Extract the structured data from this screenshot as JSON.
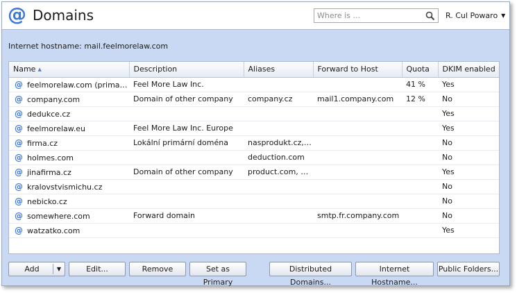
{
  "header": {
    "title": "Domains",
    "search_placeholder": "Where is ...",
    "user_name": "R. Cul Powaro"
  },
  "hostname_label": "Internet hostname: mail.feelmorelaw.com",
  "table": {
    "columns": [
      "Name",
      "Description",
      "Aliases",
      "Forward to Host",
      "Quota",
      "DKIM enabled"
    ],
    "sorted_column": "Name",
    "rows": [
      {
        "name": "feelmorelaw.com (primary)",
        "description": "Feel More Law Inc.",
        "aliases": "",
        "forward": "",
        "quota": "41 %",
        "dkim": "Yes"
      },
      {
        "name": "company.com",
        "description": "Domain of other company",
        "aliases": "company.cz",
        "forward": "mail1.company.com",
        "quota": "12 %",
        "dkim": "No"
      },
      {
        "name": "dedukce.cz",
        "description": "",
        "aliases": "",
        "forward": "",
        "quota": "",
        "dkim": "Yes"
      },
      {
        "name": "feelmorelaw.eu",
        "description": "Feel More Law Inc. Europe",
        "aliases": "",
        "forward": "",
        "quota": "",
        "dkim": "Yes"
      },
      {
        "name": "firma.cz",
        "description": "Lokální primární doména",
        "aliases": "nasprodukt.cz, fi...",
        "forward": "",
        "quota": "",
        "dkim": "No"
      },
      {
        "name": "holmes.com",
        "description": "",
        "aliases": "deduction.com",
        "forward": "",
        "quota": "",
        "dkim": "No"
      },
      {
        "name": "jinafirma.cz",
        "description": "Domain of other company",
        "aliases": "product.com, oth...",
        "forward": "",
        "quota": "",
        "dkim": "Yes"
      },
      {
        "name": "kralovstvismichu.cz",
        "description": "",
        "aliases": "",
        "forward": "",
        "quota": "",
        "dkim": "No"
      },
      {
        "name": "nebicko.cz",
        "description": "",
        "aliases": "",
        "forward": "",
        "quota": "",
        "dkim": "No"
      },
      {
        "name": "somewhere.com",
        "description": "Forward domain",
        "aliases": "",
        "forward": "smtp.fr.company.com",
        "quota": "",
        "dkim": "No"
      },
      {
        "name": "watzatko.com",
        "description": "",
        "aliases": "",
        "forward": "",
        "quota": "",
        "dkim": "Yes"
      }
    ]
  },
  "buttons": {
    "add": "Add",
    "edit": "Edit...",
    "remove": "Remove",
    "set_primary": "Set as Primary",
    "distributed": "Distributed Domains...",
    "internet_hostname": "Internet Hostname...",
    "public_folders": "Public Folders..."
  },
  "colors": {
    "accent": "#3a78d8",
    "panel_background": "#c9d9f3"
  }
}
